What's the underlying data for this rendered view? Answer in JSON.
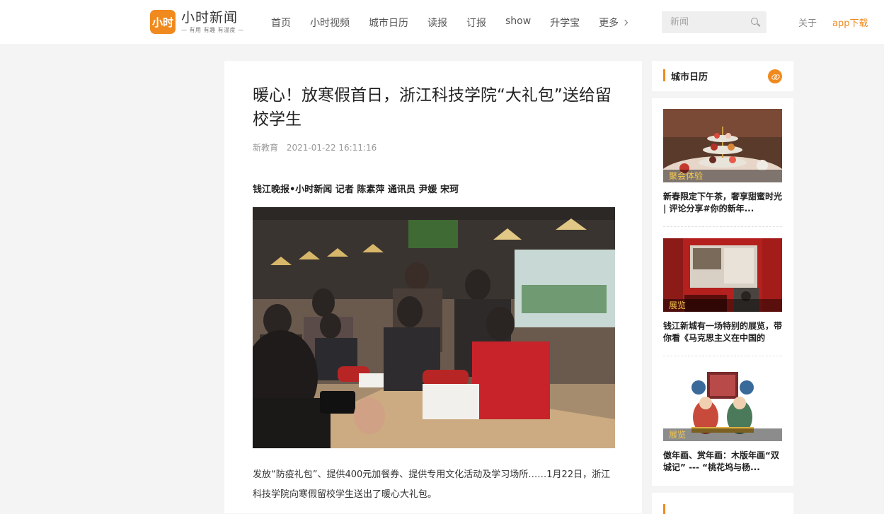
{
  "header": {
    "logo_badge": "小时",
    "logo_name": "小时新闻",
    "logo_slogan": "— 有用 有趣 有温度 —",
    "nav": [
      "首页",
      "小时视频",
      "城市日历",
      "读报",
      "订报",
      "show",
      "升学宝"
    ],
    "nav_more": "更多",
    "search_placeholder": "新闻",
    "about": "关于",
    "app_download": "app下载",
    "accent_color": "#f08a1e"
  },
  "article": {
    "title": "暖心！放寒假首日，浙江科技学院“大礼包”送给留校学生",
    "source": "新教育",
    "datetime": "2021-01-22 16:11:16",
    "byline": "钱江晚报•小时新闻 记者 陈素萍 通讯员 尹媛 宋珂",
    "paragraph": "发放“防疫礼包”、提供400元加餐券、提供专用文化活动及学习场所……1月22日，浙江科技学院向寒假留校学生送出了暖心大礼包。"
  },
  "sidebar": {
    "title": "城市日历",
    "cards": [
      {
        "tag": "聚会体验",
        "title": "新春限定下午茶，奢享甜蜜时光 | 评论分享#你的新年..."
      },
      {
        "tag": "展览",
        "title": "钱江新城有一场特别的展览，带你看《马克思主义在中国的传..."
      },
      {
        "tag": "展览",
        "title": "傲年画、赏年画：木版年画“双城记” --- “桃花坞与杨..."
      }
    ]
  }
}
